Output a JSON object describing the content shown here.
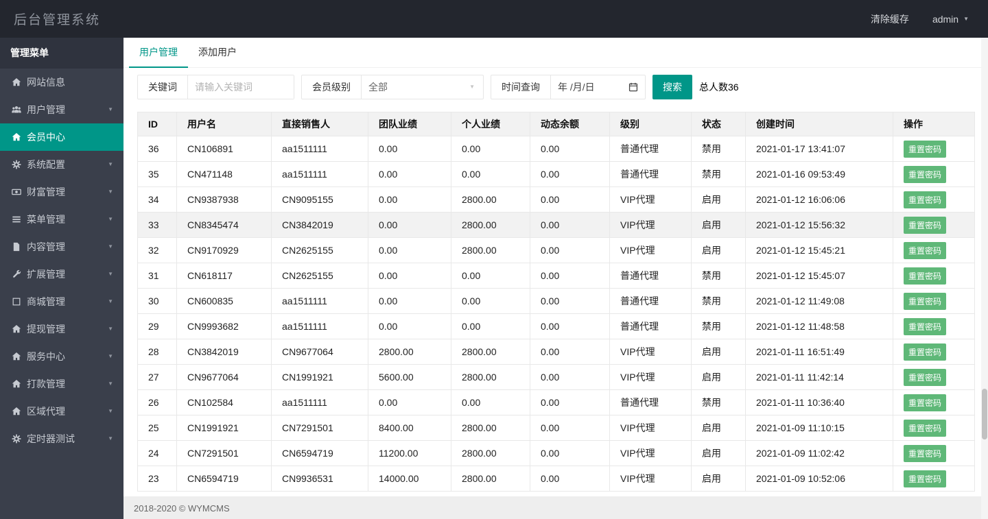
{
  "topbar": {
    "title": "后台管理系统",
    "clear_cache_label": "清除缓存",
    "username": "admin"
  },
  "sidebar": {
    "header": "管理菜单",
    "items": [
      {
        "key": "site-info",
        "label": "网站信息",
        "icon": "home-icon",
        "has_chevron": false,
        "active": false
      },
      {
        "key": "user-management",
        "label": "用户管理",
        "icon": "users-icon",
        "has_chevron": true,
        "active": false
      },
      {
        "key": "member-center",
        "label": "会员中心",
        "icon": "home-icon",
        "has_chevron": false,
        "active": true
      },
      {
        "key": "system-config",
        "label": "系统配置",
        "icon": "gears-icon",
        "has_chevron": true,
        "active": false
      },
      {
        "key": "wealth-management",
        "label": "财富管理",
        "icon": "money-icon",
        "has_chevron": true,
        "active": false
      },
      {
        "key": "menu-management",
        "label": "菜单管理",
        "icon": "list-icon",
        "has_chevron": true,
        "active": false
      },
      {
        "key": "content-management",
        "label": "内容管理",
        "icon": "file-icon",
        "has_chevron": true,
        "active": false
      },
      {
        "key": "extension-management",
        "label": "扩展管理",
        "icon": "wrench-icon",
        "has_chevron": true,
        "active": false
      },
      {
        "key": "mall-management",
        "label": "商城管理",
        "icon": "box-icon",
        "has_chevron": true,
        "active": false
      },
      {
        "key": "withdrawal-management",
        "label": "提现管理",
        "icon": "home-icon",
        "has_chevron": true,
        "active": false
      },
      {
        "key": "service-center",
        "label": "服务中心",
        "icon": "home-icon",
        "has_chevron": true,
        "active": false
      },
      {
        "key": "payment-management",
        "label": "打款管理",
        "icon": "home-icon",
        "has_chevron": true,
        "active": false
      },
      {
        "key": "regional-agent",
        "label": "区域代理",
        "icon": "home-icon",
        "has_chevron": true,
        "active": false
      },
      {
        "key": "timer-test",
        "label": "定时器测试",
        "icon": "gears-icon",
        "has_chevron": true,
        "active": false
      }
    ]
  },
  "tabs": [
    {
      "key": "user-management",
      "label": "用户管理",
      "active": true
    },
    {
      "key": "add-user",
      "label": "添加用户",
      "active": false
    }
  ],
  "filters": {
    "keyword_label": "关键词",
    "keyword_value": "",
    "keyword_placeholder": "请输入关键词",
    "level_label": "会员级别",
    "level_value": "全部",
    "time_label": "时间查询",
    "date_value": "年 /月/日",
    "search_label": "搜索",
    "total_label": "总人数36"
  },
  "table": {
    "headers": [
      "ID",
      "用户名",
      "直接销售人",
      "团队业绩",
      "个人业绩",
      "动态余额",
      "级别",
      "状态",
      "创建时间",
      "操作"
    ],
    "action_label": "重置密码",
    "rows": [
      {
        "id": "36",
        "username": "CN106891",
        "direct_seller": "aa1511111",
        "team_perf": "0.00",
        "personal_perf": "0.00",
        "dynamic_balance": "0.00",
        "level": "普通代理",
        "status": "禁用",
        "created": "2021-01-17 13:41:07",
        "highlighted": false
      },
      {
        "id": "35",
        "username": "CN471148",
        "direct_seller": "aa1511111",
        "team_perf": "0.00",
        "personal_perf": "0.00",
        "dynamic_balance": "0.00",
        "level": "普通代理",
        "status": "禁用",
        "created": "2021-01-16 09:53:49",
        "highlighted": false
      },
      {
        "id": "34",
        "username": "CN9387938",
        "direct_seller": "CN9095155",
        "team_perf": "0.00",
        "personal_perf": "2800.00",
        "dynamic_balance": "0.00",
        "level": "VIP代理",
        "status": "启用",
        "created": "2021-01-12 16:06:06",
        "highlighted": false
      },
      {
        "id": "33",
        "username": "CN8345474",
        "direct_seller": "CN3842019",
        "team_perf": "0.00",
        "personal_perf": "2800.00",
        "dynamic_balance": "0.00",
        "level": "VIP代理",
        "status": "启用",
        "created": "2021-01-12 15:56:32",
        "highlighted": true
      },
      {
        "id": "32",
        "username": "CN9170929",
        "direct_seller": "CN2625155",
        "team_perf": "0.00",
        "personal_perf": "2800.00",
        "dynamic_balance": "0.00",
        "level": "VIP代理",
        "status": "启用",
        "created": "2021-01-12 15:45:21",
        "highlighted": false
      },
      {
        "id": "31",
        "username": "CN618117",
        "direct_seller": "CN2625155",
        "team_perf": "0.00",
        "personal_perf": "0.00",
        "dynamic_balance": "0.00",
        "level": "普通代理",
        "status": "禁用",
        "created": "2021-01-12 15:45:07",
        "highlighted": false
      },
      {
        "id": "30",
        "username": "CN600835",
        "direct_seller": "aa1511111",
        "team_perf": "0.00",
        "personal_perf": "0.00",
        "dynamic_balance": "0.00",
        "level": "普通代理",
        "status": "禁用",
        "created": "2021-01-12 11:49:08",
        "highlighted": false
      },
      {
        "id": "29",
        "username": "CN9993682",
        "direct_seller": "aa1511111",
        "team_perf": "0.00",
        "personal_perf": "0.00",
        "dynamic_balance": "0.00",
        "level": "普通代理",
        "status": "禁用",
        "created": "2021-01-12 11:48:58",
        "highlighted": false
      },
      {
        "id": "28",
        "username": "CN3842019",
        "direct_seller": "CN9677064",
        "team_perf": "2800.00",
        "personal_perf": "2800.00",
        "dynamic_balance": "0.00",
        "level": "VIP代理",
        "status": "启用",
        "created": "2021-01-11 16:51:49",
        "highlighted": false
      },
      {
        "id": "27",
        "username": "CN9677064",
        "direct_seller": "CN1991921",
        "team_perf": "5600.00",
        "personal_perf": "2800.00",
        "dynamic_balance": "0.00",
        "level": "VIP代理",
        "status": "启用",
        "created": "2021-01-11 11:42:14",
        "highlighted": false
      },
      {
        "id": "26",
        "username": "CN102584",
        "direct_seller": "aa1511111",
        "team_perf": "0.00",
        "personal_perf": "0.00",
        "dynamic_balance": "0.00",
        "level": "普通代理",
        "status": "禁用",
        "created": "2021-01-11 10:36:40",
        "highlighted": false
      },
      {
        "id": "25",
        "username": "CN1991921",
        "direct_seller": "CN7291501",
        "team_perf": "8400.00",
        "personal_perf": "2800.00",
        "dynamic_balance": "0.00",
        "level": "VIP代理",
        "status": "启用",
        "created": "2021-01-09 11:10:15",
        "highlighted": false
      },
      {
        "id": "24",
        "username": "CN7291501",
        "direct_seller": "CN6594719",
        "team_perf": "11200.00",
        "personal_perf": "2800.00",
        "dynamic_balance": "0.00",
        "level": "VIP代理",
        "status": "启用",
        "created": "2021-01-09 11:02:42",
        "highlighted": false
      },
      {
        "id": "23",
        "username": "CN6594719",
        "direct_seller": "CN9936531",
        "team_perf": "14000.00",
        "personal_perf": "2800.00",
        "dynamic_balance": "0.00",
        "level": "VIP代理",
        "status": "启用",
        "created": "2021-01-09 10:52:06",
        "highlighted": false
      }
    ]
  },
  "footer": {
    "copyright": "2018-2020 © WYMCMS"
  },
  "colors": {
    "accent": "#009688",
    "button_green": "#5FB878",
    "topbar_bg": "#23262E",
    "sidebar_bg": "#3A3F4B"
  }
}
